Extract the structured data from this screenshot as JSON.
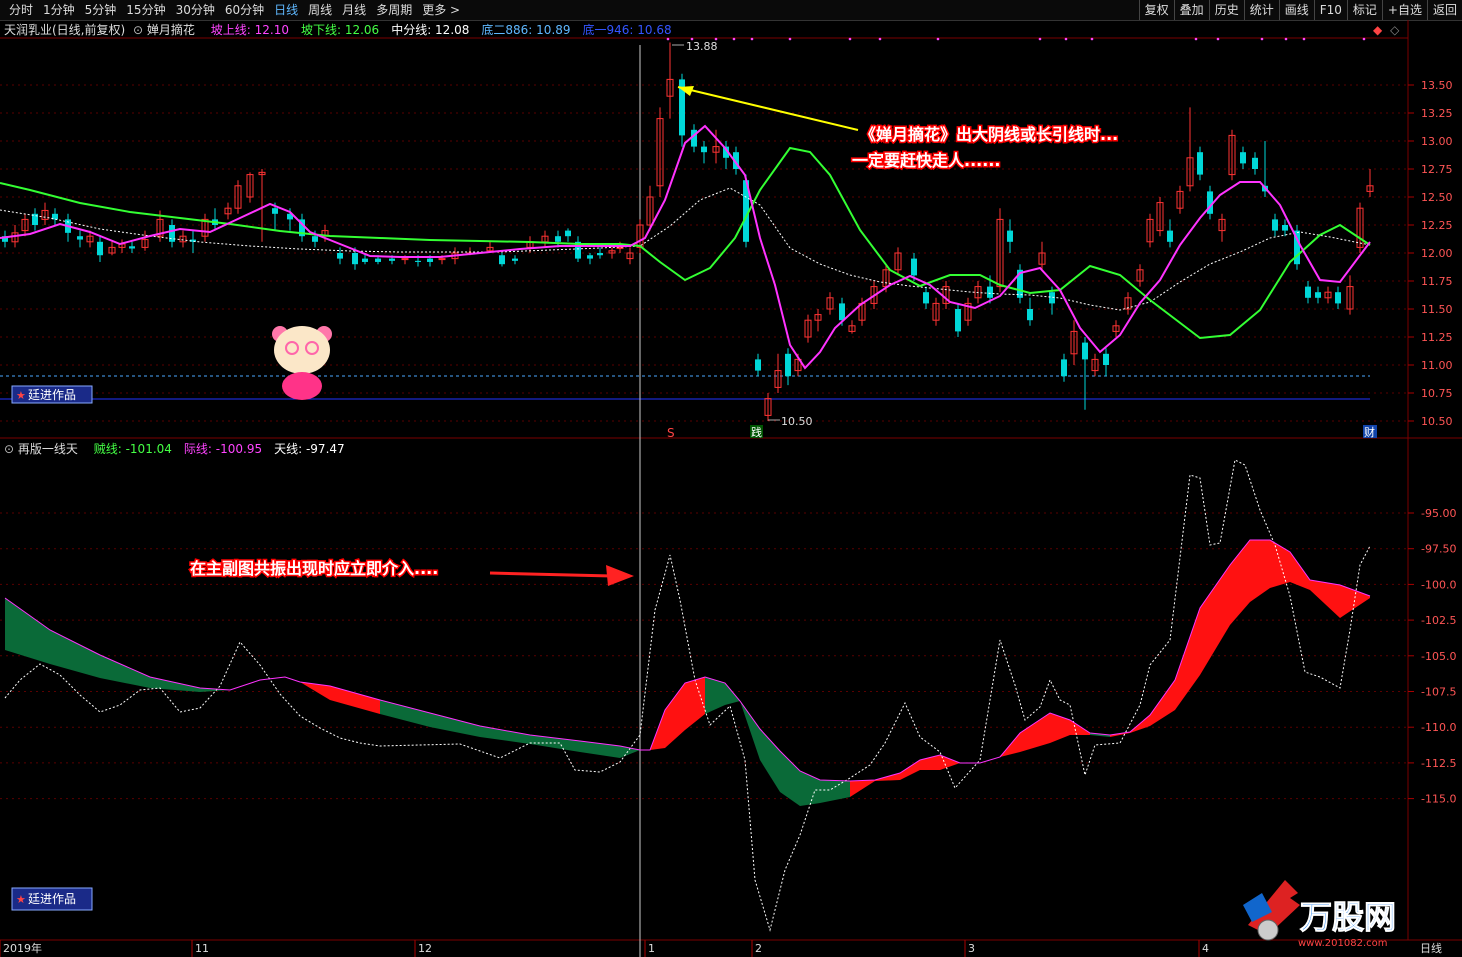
{
  "toolbar": {
    "periods": [
      "分时",
      "1分钟",
      "5分钟",
      "15分钟",
      "30分钟",
      "60分钟",
      "日线",
      "周线",
      "月线",
      "多周期",
      "更多 >"
    ],
    "active_period": "日线",
    "tools": [
      "复权",
      "叠加",
      "历史",
      "统计",
      "画线",
      "F10",
      "标记",
      "+自选",
      "返回"
    ]
  },
  "main_panel": {
    "stock_title": "天润乳业(日线,前复权)",
    "indicator_name": "婵月摘花",
    "labels": [
      {
        "text": "坡上线: 12.10",
        "color": "#ff44ff"
      },
      {
        "text": "坡下线: 12.06",
        "color": "#44ff44"
      },
      {
        "text": "中分线: 12.08",
        "color": "#ffffff"
      },
      {
        "text": "底二886: 10.89",
        "color": "#5fb8ff"
      },
      {
        "text": "底一946: 10.68",
        "color": "#3355ff"
      }
    ],
    "price_axis": [
      "13.50",
      "13.25",
      "13.00",
      "12.75",
      "12.50",
      "12.25",
      "12.00",
      "11.75",
      "11.50",
      "11.25",
      "11.00",
      "10.75",
      "10.50"
    ],
    "high_label": "13.88",
    "low_label": "10.50",
    "markers": {
      "s": "S",
      "buy": "践",
      "fin": "财"
    },
    "annotation_line1": "《婵月摘花》出大阴线或长引线时...",
    "annotation_line2": "一定要赶快走人......",
    "author_badge": "廷进作品"
  },
  "sub_panel": {
    "indicator_name": "再版一线天",
    "labels": [
      {
        "text": "贼线: -101.04",
        "color": "#44ff44"
      },
      {
        "text": "际线: -100.95",
        "color": "#ff44ff"
      },
      {
        "text": "天线: -97.47",
        "color": "#ffffff"
      }
    ],
    "axis": [
      "-95.00",
      "-97.50",
      "-100.0",
      "-102.5",
      "-105.0",
      "-107.5",
      "-110.0",
      "-112.5",
      "-115.0"
    ],
    "annotation": "在主副图共振出现时应立即介入....",
    "author_badge": "廷进作品"
  },
  "date_axis": [
    "2019年",
    "11",
    "12",
    "1",
    "2",
    "3",
    "4"
  ],
  "period_label": "日线",
  "watermark": {
    "brand": "万股网",
    "url": "www.201082.com"
  },
  "colors": {
    "up": "#ff3333",
    "down": "#00d8d8",
    "pink": "#ff33ff",
    "green": "#33ff33",
    "bg": "#000000"
  }
}
